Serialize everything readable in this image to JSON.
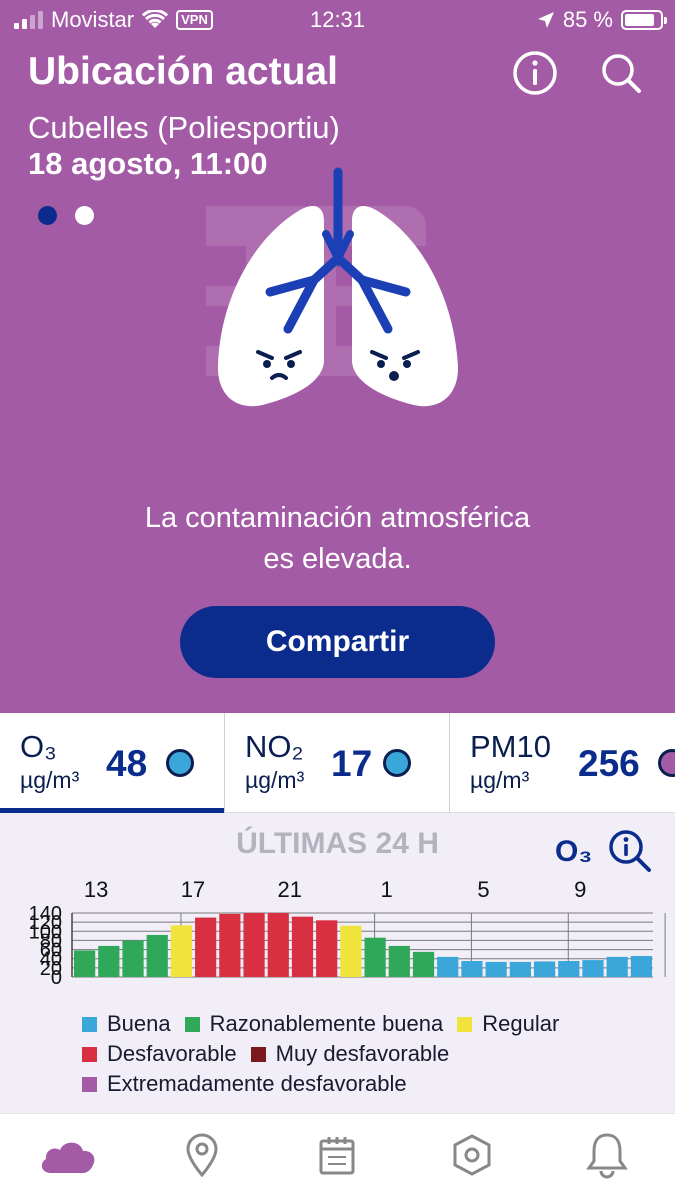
{
  "status_bar": {
    "carrier": "Movistar",
    "vpn": "VPN",
    "time": "12:31",
    "battery": "85 %",
    "battery_level": 0.85
  },
  "header": {
    "title": "Ubicación actual",
    "station": "Cubelles (Poliesportiu)",
    "datetime": "18 agosto, 11:00",
    "info_icon": "info-icon",
    "search_icon": "search-icon"
  },
  "pager": {
    "pages": 2,
    "active": 0
  },
  "message": {
    "line1": "La contaminación atmosférica",
    "line2": "es elevada."
  },
  "share_button": "Compartir",
  "pollutants": [
    {
      "name": "O₃",
      "unit": "µg/m³",
      "value": "48",
      "color": "#3aa6d9",
      "selected": true
    },
    {
      "name": "NO₂",
      "unit": "µg/m³",
      "value": "17",
      "color": "#3aa6d9",
      "selected": false
    },
    {
      "name": "PM10",
      "unit": "µg/m³",
      "value": "256",
      "color": "#a35ba6",
      "selected": false
    }
  ],
  "chart_section": {
    "title": "ÚLTIMAS 24 H",
    "pollutant": "O₃",
    "zoom_icon": "zoom-info-icon"
  },
  "chart_data": {
    "type": "bar",
    "x_ticks": [
      "13",
      "17",
      "21",
      "1",
      "5",
      "9"
    ],
    "y_ticks": [
      "140",
      "120",
      "100",
      "80",
      "60",
      "40",
      "20",
      "0"
    ],
    "ylim": [
      0,
      140
    ],
    "values": [
      58,
      68,
      80,
      92,
      113,
      130,
      138,
      140,
      140,
      132,
      124,
      112,
      86,
      68,
      55,
      44,
      35,
      33,
      33,
      34,
      35,
      37,
      44,
      46
    ],
    "categories_per_bar": [
      "Razonablemente buena",
      "Razonablemente buena",
      "Razonablemente buena",
      "Razonablemente buena",
      "Regular",
      "Desfavorable",
      "Desfavorable",
      "Desfavorable",
      "Desfavorable",
      "Desfavorable",
      "Desfavorable",
      "Regular",
      "Razonablemente buena",
      "Razonablemente buena",
      "Razonablemente buena",
      "Buena",
      "Buena",
      "Buena",
      "Buena",
      "Buena",
      "Buena",
      "Buena",
      "Buena",
      "Buena"
    ],
    "grid": true
  },
  "legend": [
    {
      "label": "Buena",
      "color": "#3aa6d9"
    },
    {
      "label": "Razonablemente buena",
      "color": "#2fa85a"
    },
    {
      "label": "Regular",
      "color": "#f0e43c"
    },
    {
      "label": "Desfavorable",
      "color": "#d83040"
    },
    {
      "label": "Muy desfavorable",
      "color": "#7a1a1e"
    },
    {
      "label": "Extremadamente desfavorable",
      "color": "#a35ba6"
    }
  ],
  "nav": [
    "cloud-icon",
    "location-pin-icon",
    "calendar-icon",
    "hexagon-settings-icon",
    "bell-icon"
  ]
}
